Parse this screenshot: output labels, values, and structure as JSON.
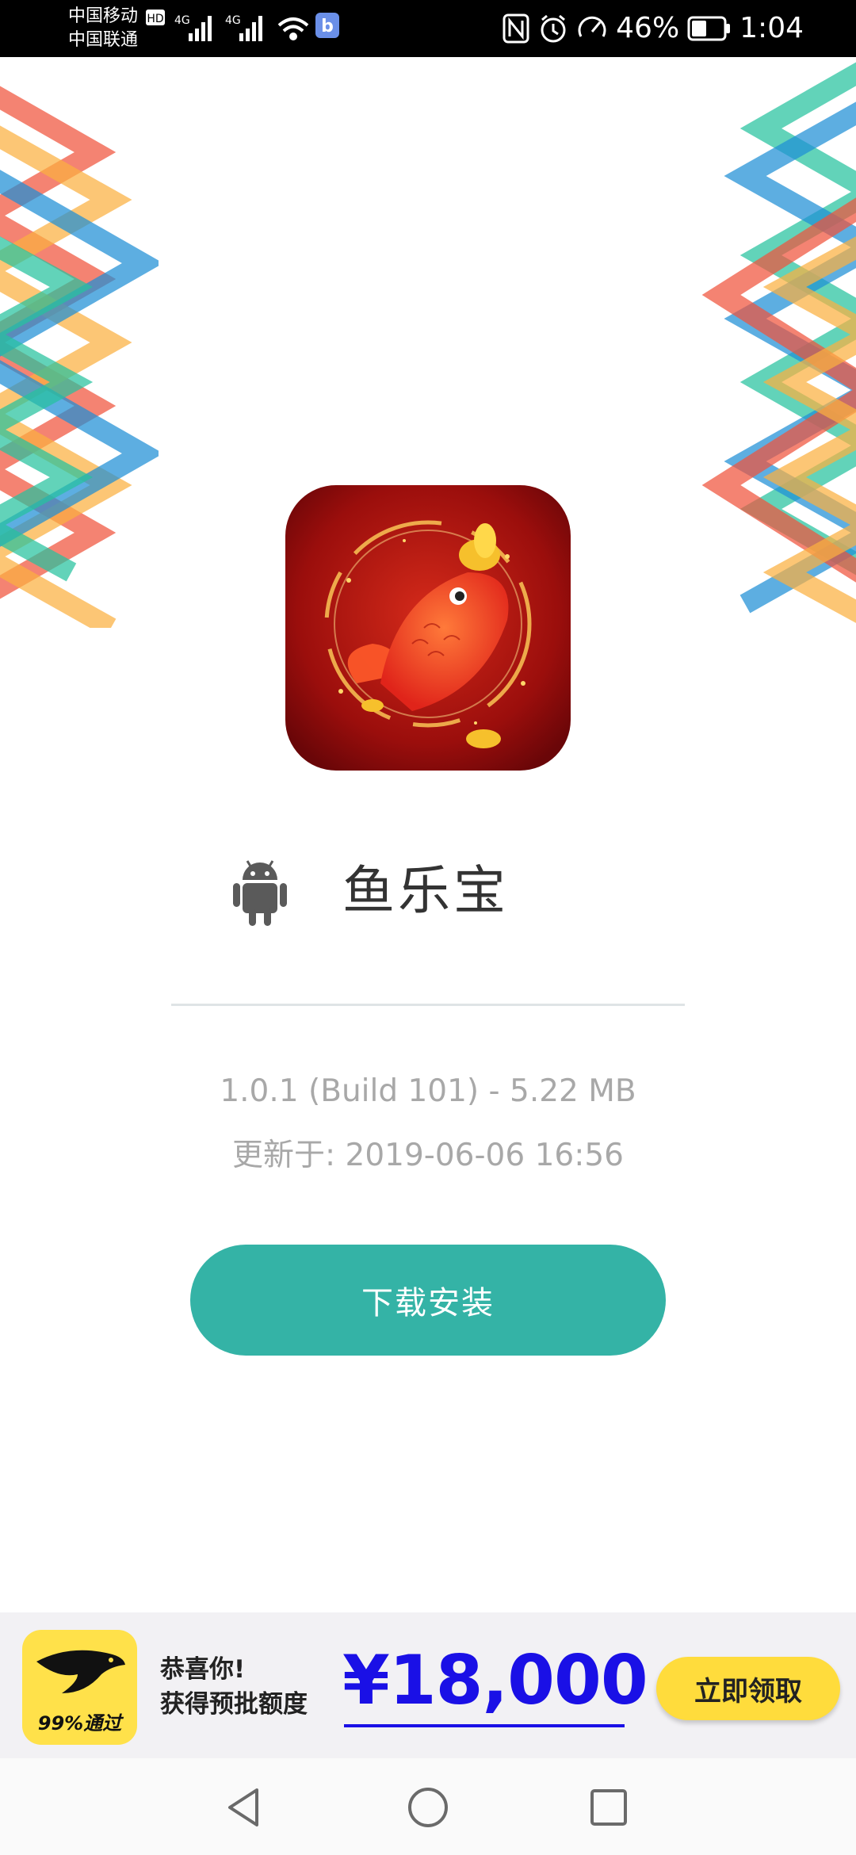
{
  "status_bar": {
    "carrier1": "中国移动",
    "carrier2": "中国联通",
    "hd": "HD",
    "net1": "4G",
    "net2": "4G",
    "battery_percent": "46%",
    "time": "1:04"
  },
  "app": {
    "icon": "koi-fish-app-icon",
    "platform_icon": "android-icon",
    "name": "鱼乐宝",
    "version_info": "1.0.1 (Build 101) - 5.22 MB",
    "updated": "更新于: 2019-06-06 16:56",
    "download_label": "下载安装"
  },
  "ad": {
    "logo_text": "99%通过",
    "line1": "恭喜你!",
    "line2": "获得预批额度",
    "amount": "¥18,000",
    "claim_label": "立即领取",
    "amount_color": "#1a10e6",
    "button_color": "#ffdc3c"
  },
  "nav_bar": {
    "back": "back-triangle-icon",
    "home": "home-circle-icon",
    "recents": "recents-square-icon"
  },
  "colors": {
    "accent": "#34b3a6",
    "deco": [
      "#f0533b",
      "#fbb040",
      "#1e8fd6",
      "#26c29e"
    ]
  }
}
